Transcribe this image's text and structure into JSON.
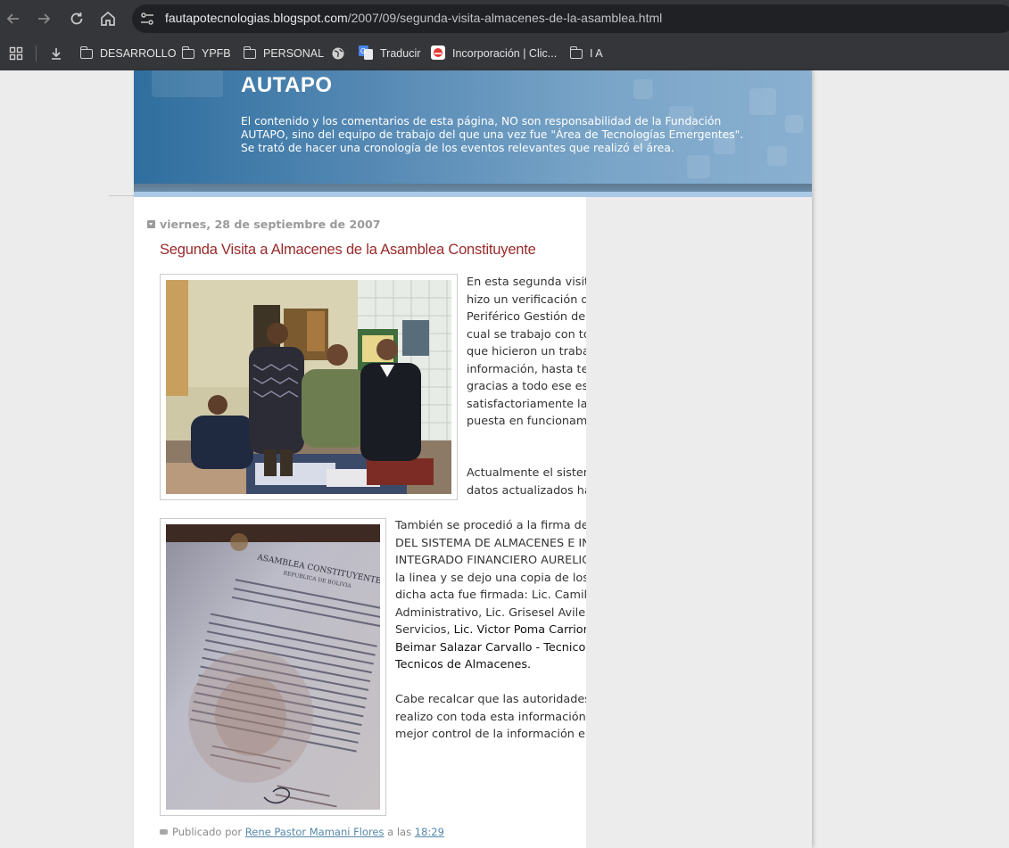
{
  "browser": {
    "url_host": "fautapotecnologias.blogspot.com",
    "url_path": "/2007/09/segunda-visita-almacenes-de-la-asamblea.html",
    "nav_icons": [
      "back-arrow-icon",
      "forward-arrow-icon",
      "reload-icon",
      "home-icon"
    ]
  },
  "bookmarks": [
    {
      "label": "DESARROLLO",
      "icon": "folder-icon"
    },
    {
      "label": "YPFB",
      "icon": "folder-icon"
    },
    {
      "label": "PERSONAL",
      "icon": "folder-icon"
    },
    {
      "label": "Traducir",
      "icon": "translate-icon"
    },
    {
      "label": "Incorporación | Clic...",
      "icon": "site-icon"
    },
    {
      "label": "I A",
      "icon": "folder-icon"
    }
  ],
  "blog": {
    "title": "AUTAPO",
    "description": "El contenido y los comentarios de esta página, NO son responsabilidad de la Fundación AUTAPO, sino del equipo de trabajo del que una vez fue \"Área de Tecnologías Emergentes\". Se trató de hacer una cronología de los eventos relevantes que realizó el área."
  },
  "post": {
    "date": "viernes, 28 de septiembre de 2007",
    "title": "Segunda Visita a Almacenes de la Asamblea Constituyente",
    "paragraph1": "En esta segunda visita a la Asamblea Constituyente se hizo un verificación de la información para el Sistema Periférico Gestión de Almacenes e Inventarios, para lo cual se trabajo con todo el personal de almacenes los que hicieron un trabajo minucioso de revisión de toda la información, hasta tempranas horas del dia siguiente, gracias a todo ese esfuerzo se concluyo satisfactoriamente la depuración de los datos, como la puesta en funcionamiento correcto del sistema.",
    "paragraph2": "Actualmente el sistema esta en marcha con todos los datos actualizados hasta la fecha.",
    "paragraph3_a": "También se procedió a la firma del ACTA DE ENTREGA-RECEPCIÓN DEL SISTEMA DE ALMACENES E INVENTARIOS DEL SISTEMA INTEGRADO FINANCIERO AURELIO, para lo cual se vio el sistema en la linea y se dejo una copia de los reportes que emite el sistema, dicha acta fue firmada: Lic. Camilo Torres Arandia - Oficial Mayor Administrativo, Lic. Grisesel Aviles Teran - Directora de Bienes y Servicios, ",
    "paragraph3_b": "Lic. Victor Poma Carrion – Responsable de Almacenes, Beimar Salazar Carvallo - Tecnicos de Almacenes, Marvin Bravo – Tecnicos de Almacenes.",
    "paragraph4": "Cabe recalcar que las autoridades agradecieron por el trabajo que se realizo con toda esta información ya que esto les permitirá tener un mejor control de la información en almacenes.",
    "footer_published": "Publicado por",
    "footer_author": "Rene Pastor Mamani Flores",
    "footer_at": "a las",
    "footer_time": "18:29"
  },
  "document_photo": {
    "heading": "ASAMBLEA CONSTITUYENTE",
    "subheading": "REPUBLICA DE BOLIVIA"
  }
}
